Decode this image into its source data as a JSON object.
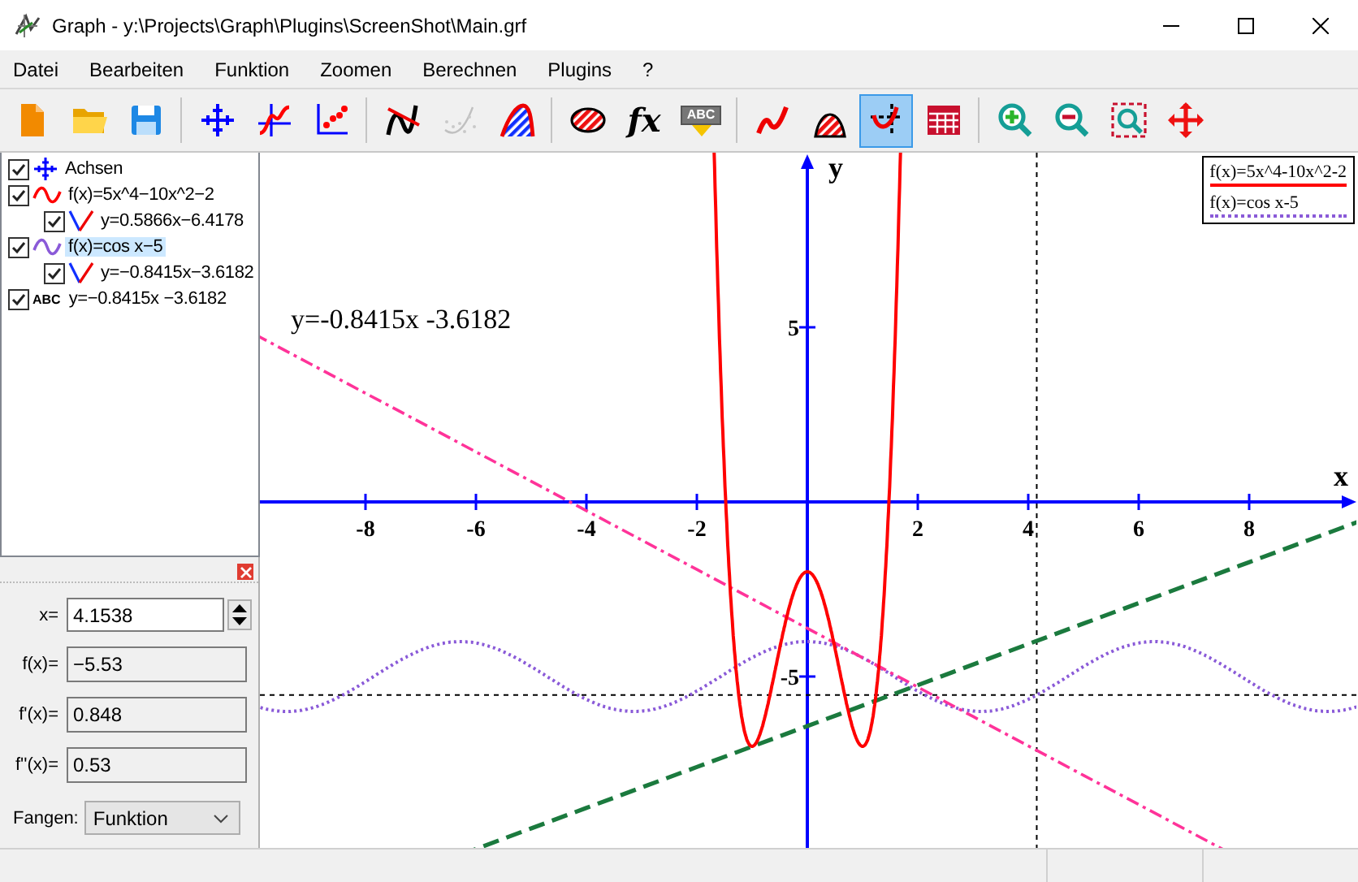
{
  "window": {
    "title": "Graph - y:\\Projects\\Graph\\Plugins\\ScreenShot\\Main.grf"
  },
  "menu": [
    "Datei",
    "Bearbeiten",
    "Funktion",
    "Zoomen",
    "Berechnen",
    "Plugins",
    "?"
  ],
  "toolbar": [
    {
      "tools": [
        {
          "kind": "icon",
          "selected": false,
          "disabled": false
        },
        {
          "kind": "icon",
          "selected": false,
          "disabled": false
        },
        {
          "kind": "icon",
          "selected": false,
          "disabled": false
        }
      ]
    },
    {
      "tools": [
        {
          "kind": "icon",
          "selected": false,
          "disabled": false
        },
        {
          "kind": "icon",
          "selected": false,
          "disabled": false
        },
        {
          "kind": "icon",
          "selected": false,
          "disabled": false
        }
      ]
    },
    {
      "tools": [
        {
          "kind": "icon",
          "selected": false,
          "disabled": false
        },
        {
          "kind": "icon",
          "selected": false,
          "disabled": true
        },
        {
          "kind": "icon",
          "selected": false,
          "disabled": false
        }
      ]
    },
    {
      "tools": [
        {
          "kind": "icon",
          "selected": false,
          "disabled": false
        },
        {
          "kind": "formula",
          "glyph": "fx",
          "selected": false,
          "disabled": false
        },
        {
          "kind": "label",
          "glyph": "ABC",
          "selected": false,
          "disabled": false
        }
      ]
    },
    {
      "tools": [
        {
          "kind": "icon",
          "selected": false,
          "disabled": false
        },
        {
          "kind": "icon",
          "selected": false,
          "disabled": false
        },
        {
          "kind": "icon",
          "selected": true,
          "disabled": false
        },
        {
          "kind": "icon",
          "selected": false,
          "disabled": false
        }
      ]
    },
    {
      "tools": [
        {
          "kind": "icon",
          "selected": false,
          "disabled": false
        },
        {
          "kind": "icon",
          "selected": false,
          "disabled": false
        },
        {
          "kind": "icon",
          "selected": false,
          "disabled": false
        },
        {
          "kind": "icon",
          "selected": false,
          "disabled": false
        }
      ]
    }
  ],
  "tree": [
    {
      "kind": "axes",
      "label": "Achsen",
      "checked": true,
      "selected": false
    },
    {
      "kind": "function",
      "label": "f(x)=5x^4−10x^2−2",
      "color": "#ff0000",
      "checked": true,
      "selected": false,
      "children": [
        {
          "kind": "tangent",
          "label": "y=0.5866x−6.4178",
          "checked": true,
          "selected": false
        }
      ]
    },
    {
      "kind": "function",
      "label": "f(x)=cos x−5",
      "color": "#8a5ad8",
      "checked": true,
      "selected": true,
      "children": [
        {
          "kind": "tangent",
          "label": "y=−0.8415x−3.6182",
          "checked": true,
          "selected": false
        }
      ]
    },
    {
      "kind": "label",
      "glyph": "ABC",
      "label": "y=−0.8415x −3.6182",
      "checked": true,
      "selected": false
    }
  ],
  "calc": {
    "x_label": "x=",
    "x_value": "4.1538",
    "rows": [
      {
        "label": "f(x)=",
        "value": "−5.53"
      },
      {
        "label": "f'(x)=",
        "value": "0.848"
      },
      {
        "label": "f''(x)=",
        "value": "0.53"
      }
    ],
    "snap_label": "Fangen:",
    "snap_value": "Funktion"
  },
  "plot": {
    "x_axis_label": "x",
    "y_axis_label": "y",
    "x_ticks": [
      "-8",
      "-6",
      "-4",
      "-2",
      "2",
      "4",
      "6",
      "8"
    ],
    "y_ticks": [
      "5",
      "-5"
    ],
    "annotation": "y=-0.8415x -3.6182",
    "legend": [
      {
        "label": "f(x)=5x^4-10x^2-2",
        "color": "#ff0000",
        "kind": "solid"
      },
      {
        "label": "f(x)=cos x-5",
        "color": "#8a5ad8",
        "kind": "dotted"
      }
    ]
  }
}
